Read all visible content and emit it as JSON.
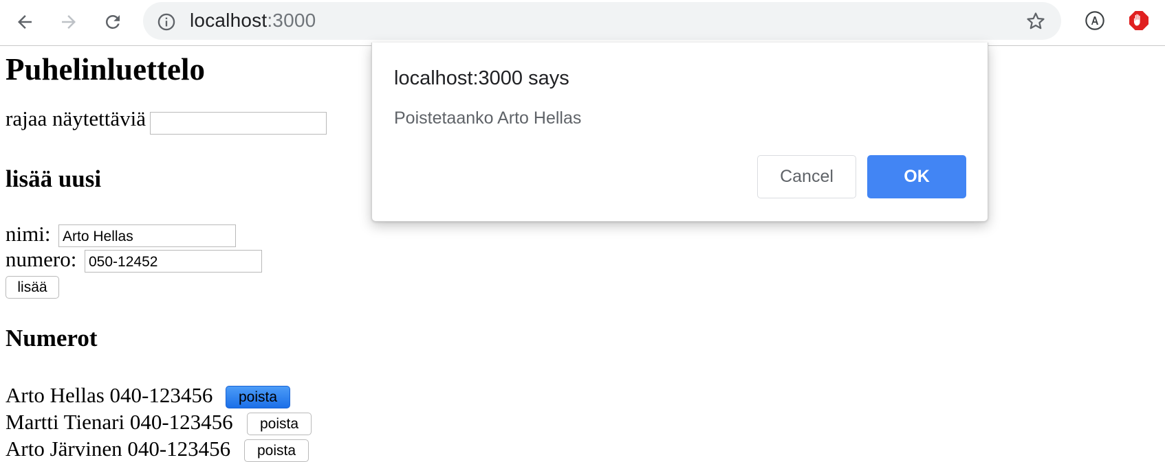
{
  "browser": {
    "url_host": "localhost",
    "url_port": ":3000"
  },
  "page": {
    "title": "Puhelinluettelo",
    "filter_label": "rajaa näytettäviä",
    "filter_value": "",
    "add_heading": "lisää uusi",
    "name_label": "nimi:",
    "name_value": "Arto Hellas",
    "number_label": "numero:",
    "number_value": "050-12452",
    "add_button": "lisää",
    "numbers_heading": "Numerot",
    "entries": [
      {
        "text": "Arto Hellas 040-123456",
        "button": "poista"
      },
      {
        "text": "Martti Tienari 040-123456",
        "button": "poista"
      },
      {
        "text": "Arto Järvinen 040-123456",
        "button": "poista"
      }
    ]
  },
  "dialog": {
    "title": "localhost:3000 says",
    "message": "Poistetaanko Arto Hellas",
    "cancel": "Cancel",
    "ok": "OK"
  },
  "colors": {
    "ok_button": "#4285f4",
    "active_delete_button": "#1b6fe8",
    "adblock_icon": "#e02020"
  }
}
